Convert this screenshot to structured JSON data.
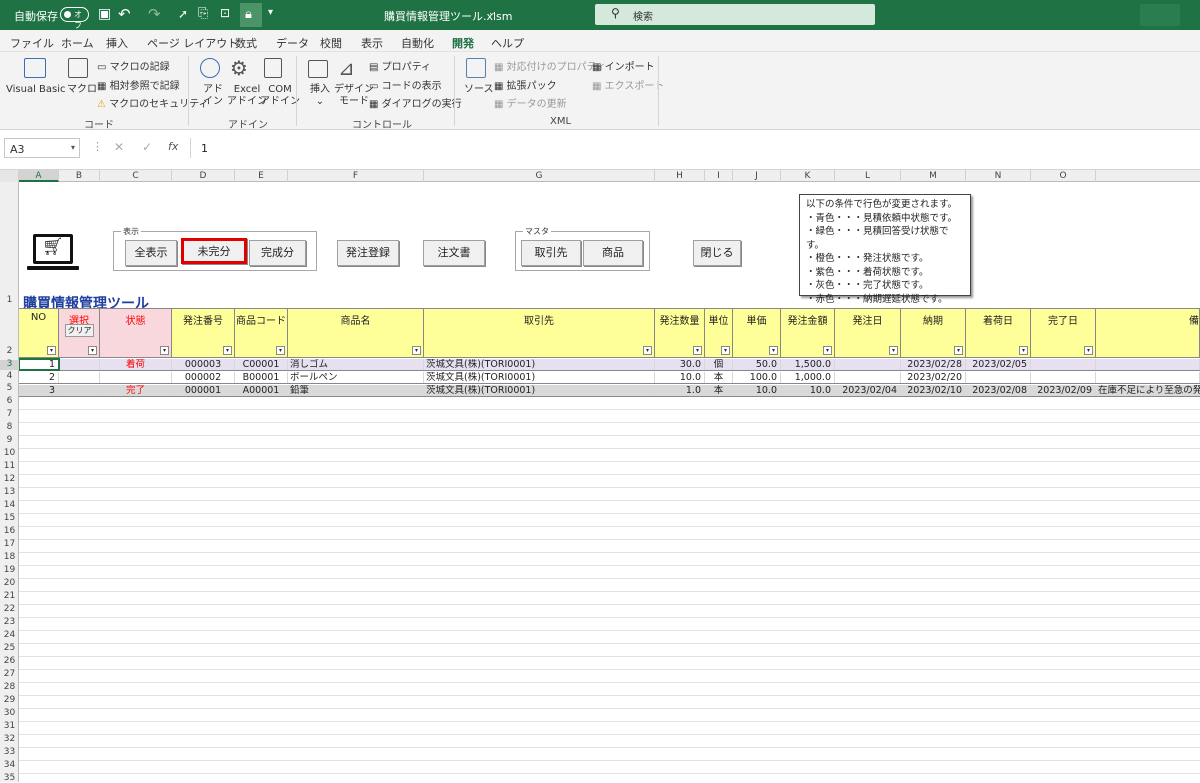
{
  "titlebar": {
    "autosave": "自動保存",
    "toggle": "オフ",
    "filename": "購買情報管理ツール.xlsm",
    "search": "検索"
  },
  "tabs": [
    "ファイル",
    "ホーム",
    "挿入",
    "ページ レイアウト",
    "数式",
    "データ",
    "校閲",
    "表示",
    "自動化",
    "開発",
    "ヘルプ"
  ],
  "active_tab": "開発",
  "ribbon": {
    "code": {
      "group": "コード",
      "vb": "Visual Basic",
      "macro": "マクロ",
      "record": "マクロの記録",
      "relative": "相対参照で記録",
      "security": "マクロのセキュリティ"
    },
    "addin": {
      "group": "アドイン",
      "addin1": "アド",
      "addin2": "イン",
      "excel1": "Excel",
      "excel2": "アドイン",
      "com1": "COM",
      "com2": "アドイン"
    },
    "controls": {
      "group": "コントロール",
      "insert": "挿入",
      "design1": "デザイン",
      "design2": "モード",
      "properties": "プロパティ",
      "viewcode": "コードの表示",
      "dialog": "ダイアログの実行"
    },
    "xml": {
      "group": "XML",
      "source": "ソース",
      "mapprops": "対応付けのプロパティ",
      "expansion": "拡張パック",
      "refresh": "データの更新",
      "import": "インポート",
      "export": "エクスポート"
    }
  },
  "formula": {
    "namebox": "A3",
    "cancel": "✕",
    "enter": "✓",
    "fx": "fx",
    "value": "1"
  },
  "columns": [
    "A",
    "B",
    "C",
    "D",
    "E",
    "F",
    "G",
    "H",
    "I",
    "J",
    "K",
    "L",
    "M",
    "N",
    "O"
  ],
  "rows": [
    "1",
    "2",
    "3",
    "4",
    "5",
    "6",
    "7",
    "8",
    "9",
    "10",
    "11",
    "12",
    "13",
    "14",
    "15",
    "16",
    "17",
    "18",
    "19",
    "20",
    "21",
    "22",
    "23",
    "24",
    "25",
    "26",
    "27",
    "28",
    "29",
    "30",
    "31",
    "32",
    "33",
    "34",
    "35"
  ],
  "sheet": {
    "groups": {
      "display": "表示",
      "master": "マスタ"
    },
    "buttons": {
      "all": "全表示",
      "incomplete": "未完分",
      "complete": "完成分",
      "order_reg": "発注登録",
      "order_doc": "注文書",
      "supplier": "取引先",
      "product": "商品",
      "close": "閉じる",
      "clear": "クリア"
    },
    "title": "購買情報管理ツール",
    "note": [
      "以下の条件で行色が変更されます。",
      "・青色・・・見積依頼中状態です。",
      "・緑色・・・見積回答受け状態です。",
      "・橙色・・・発注状態です。",
      "・紫色・・・着荷状態です。",
      "・灰色・・・完了状態です。",
      "・赤色・・・納期遅延状態です。"
    ],
    "headers": [
      "NO",
      "選択",
      "状態",
      "発注番号",
      "商品コード",
      "商品名",
      "取引先",
      "発注数量",
      "単位",
      "単価",
      "発注金額",
      "発注日",
      "納期",
      "着荷日",
      "完了日",
      "備"
    ],
    "data": [
      {
        "no": "1",
        "status": "着荷",
        "order_no": "000003",
        "code": "C00001",
        "name": "消しゴム",
        "supplier": "茨城文具(株)(TORI0001)",
        "qty": "30.0",
        "unit": "個",
        "price": "50.0",
        "amount": "1,500.0",
        "order_date": "",
        "due": "2023/02/28",
        "arrival": "2023/02/05",
        "done": "",
        "remark": ""
      },
      {
        "no": "2",
        "status": "",
        "order_no": "000002",
        "code": "B00001",
        "name": "ボールペン",
        "supplier": "茨城文具(株)(TORI0001)",
        "qty": "10.0",
        "unit": "本",
        "price": "100.0",
        "amount": "1,000.0",
        "order_date": "",
        "due": "2023/02/20",
        "arrival": "",
        "done": "",
        "remark": ""
      },
      {
        "no": "3",
        "status": "完了",
        "order_no": "000001",
        "code": "A00001",
        "name": "鉛筆",
        "supplier": "茨城文具(株)(TORI0001)",
        "qty": "1.0",
        "unit": "本",
        "price": "10.0",
        "amount": "10.0",
        "order_date": "2023/02/04",
        "due": "2023/02/10",
        "arrival": "2023/02/08",
        "done": "2023/02/09",
        "remark": "在庫不足により至急の発"
      }
    ]
  },
  "colors": {
    "excel_green": "#1f7244",
    "header_yellow": "#ffff99",
    "select_pink": "#f8d8dc",
    "row_purple": "#e6e0f0",
    "row_gray": "#d9d9d9",
    "status_red": "#ff0000",
    "title_blue": "#1f3fa0",
    "highlight_red": "#e00000"
  }
}
